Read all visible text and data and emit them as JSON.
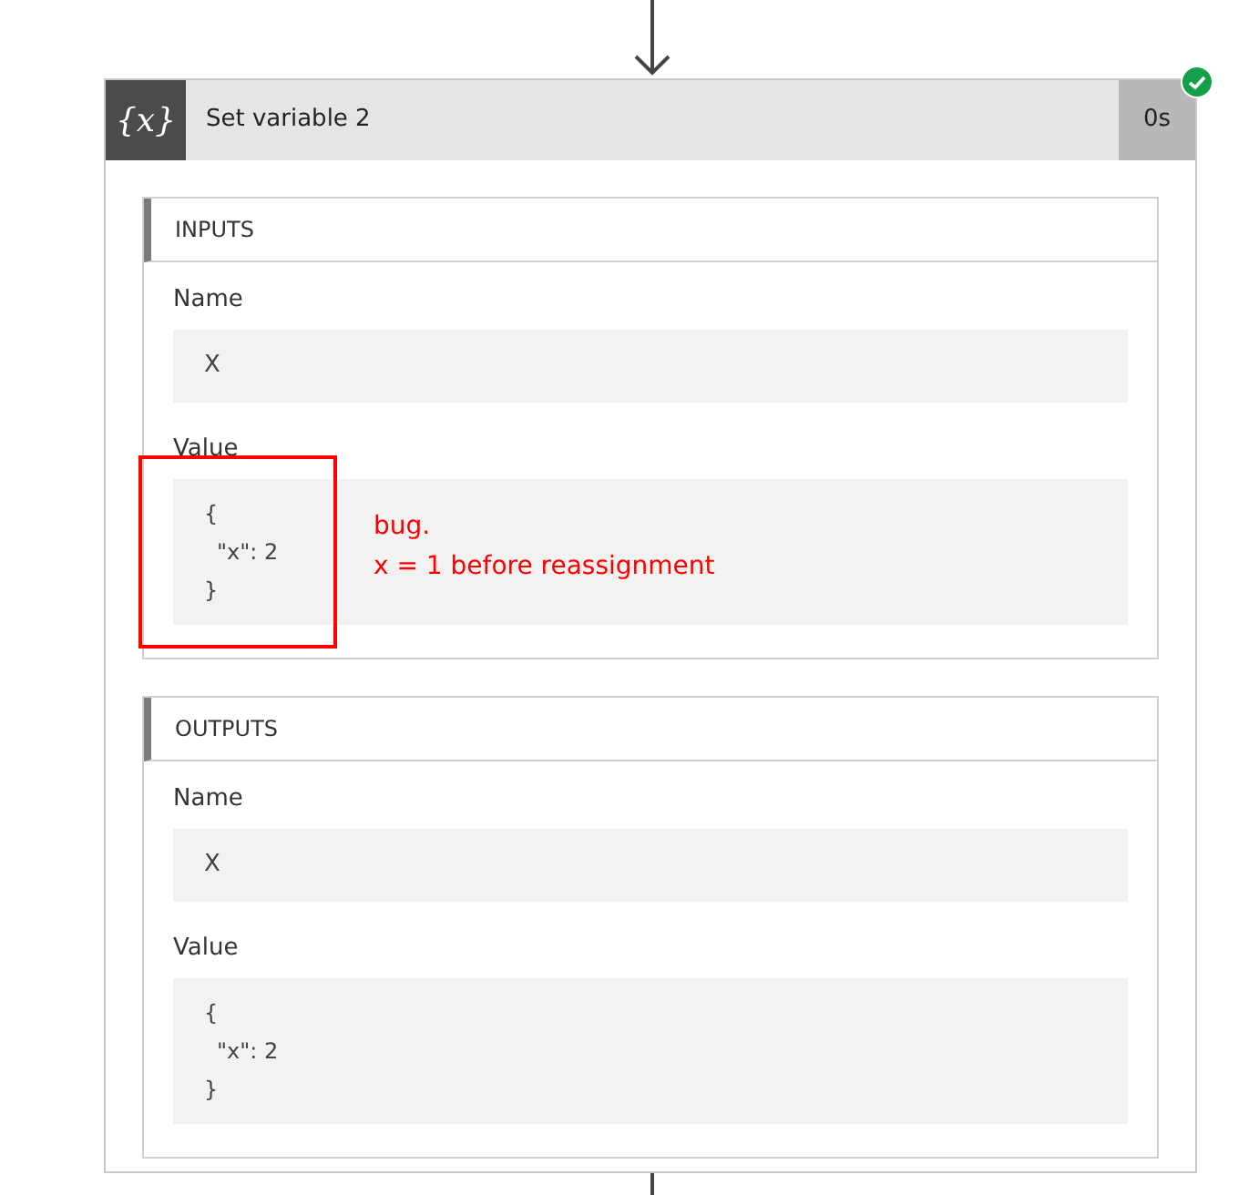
{
  "card": {
    "icon_text": "{x}",
    "title": "Set variable 2",
    "duration": "0s",
    "succeeded": true,
    "sections": [
      {
        "heading": "INPUTS",
        "fields": [
          {
            "label": "Name",
            "kind": "text",
            "value": "X"
          },
          {
            "label": "Value",
            "kind": "code",
            "lines": [
              "{",
              "\"x\": 2",
              "}"
            ],
            "annotation": {
              "lines": [
                "bug.",
                "x = 1 before reassignment"
              ]
            }
          }
        ]
      },
      {
        "heading": "OUTPUTS",
        "fields": [
          {
            "label": "Name",
            "kind": "text",
            "value": "X"
          },
          {
            "label": "Value",
            "kind": "code",
            "lines": [
              "{",
              "\"x\": 2",
              "}"
            ]
          }
        ]
      }
    ]
  }
}
